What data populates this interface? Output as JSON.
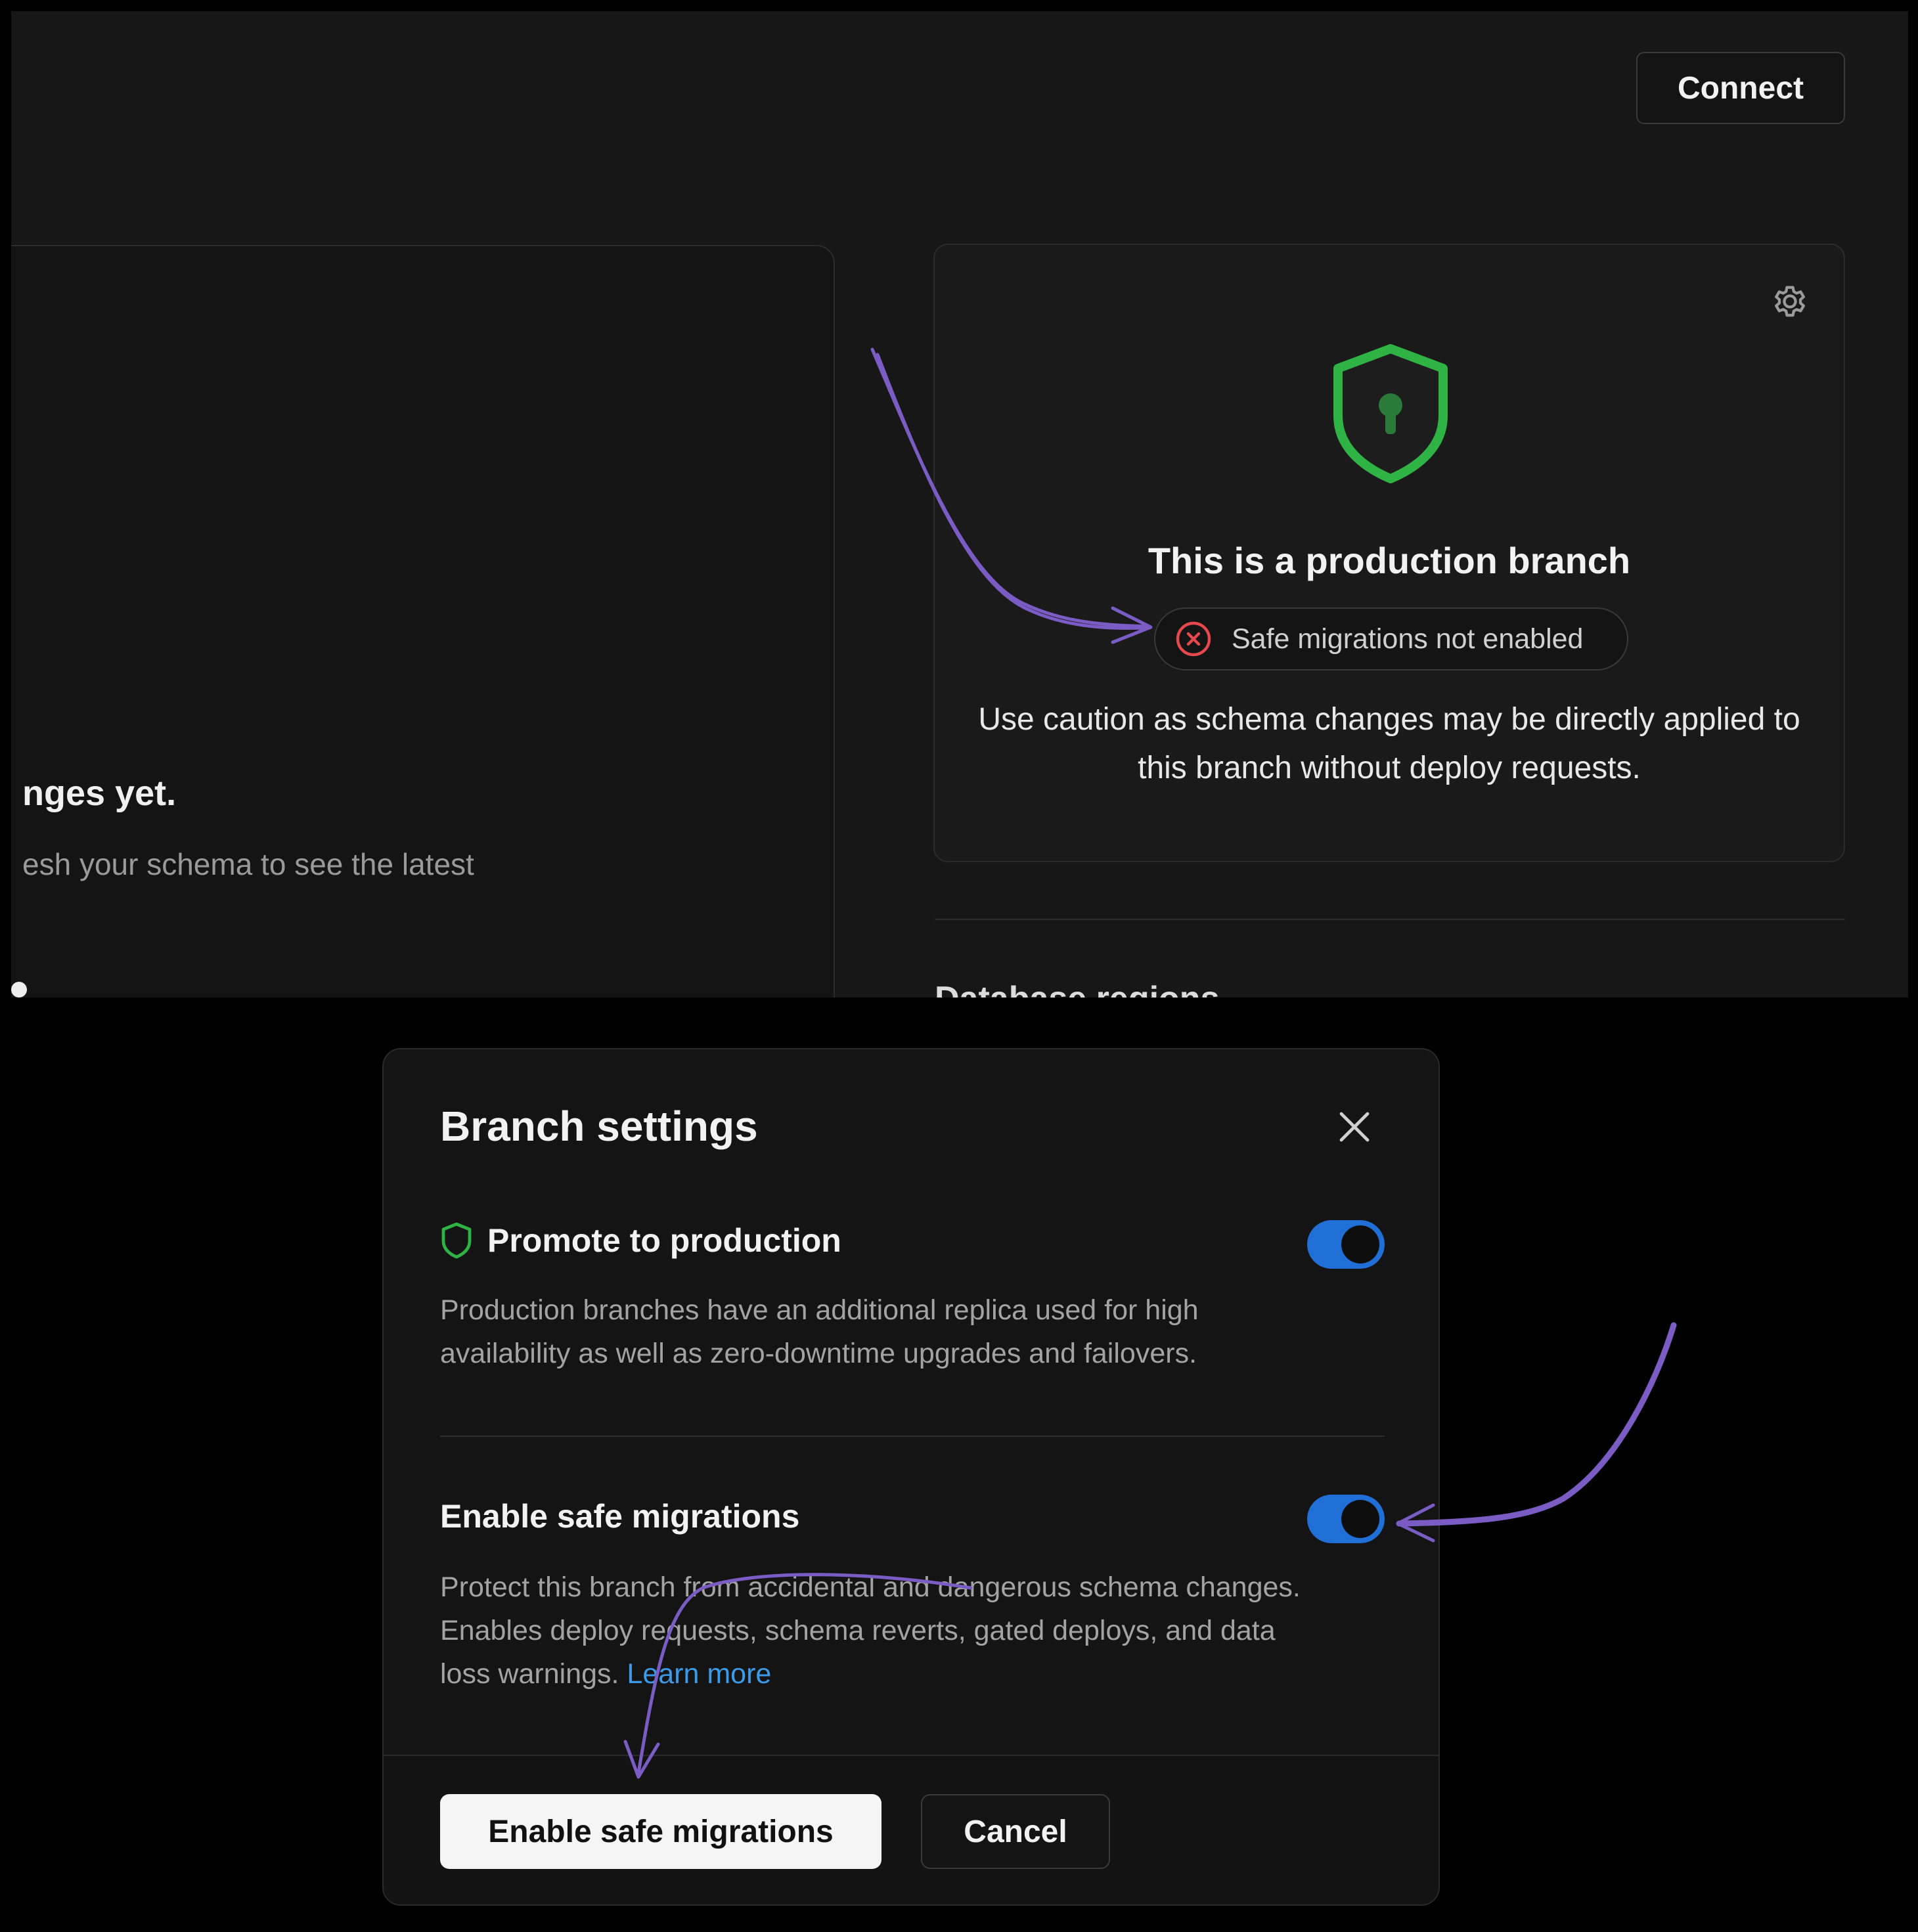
{
  "header": {
    "connect_label": "Connect"
  },
  "schema_card": {
    "title": "nges yet.",
    "subtitle": "esh your schema to see the latest"
  },
  "production_card": {
    "icons": {
      "settings": "gear-icon",
      "shield": "shield-keyhole-icon",
      "status": "x-circle-icon"
    },
    "title": "This is a production branch",
    "status_pill": "Safe migrations not enabled",
    "description": "Use caution as schema changes may be directly applied to this branch without deploy requests."
  },
  "regions": {
    "label": "Database regions"
  },
  "modal": {
    "title": "Branch settings",
    "promote": {
      "label": "Promote to production",
      "enabled": true,
      "description": "Production branches have an additional replica used for high availability as well as zero-downtime upgrades and failovers."
    },
    "safe_migrations": {
      "label": "Enable safe migrations",
      "enabled": true,
      "description": "Protect this branch from accidental and dangerous schema changes. Enables deploy requests, schema reverts, gated deploys, and data loss warnings.",
      "learn_more": "Learn more"
    },
    "footer": {
      "primary_label": "Enable safe migrations",
      "cancel_label": "Cancel"
    }
  },
  "colors": {
    "toggle_on": "#1f6fd6",
    "shield_green": "#2fb344",
    "error_red": "#e5484d",
    "link_blue": "#3b9be8",
    "annotation_purple": "#7b5cc4"
  }
}
